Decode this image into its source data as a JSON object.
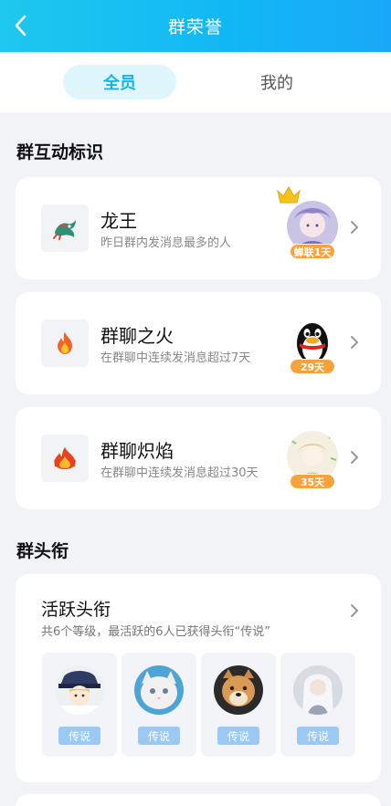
{
  "header": {
    "title": "群荣誉"
  },
  "tabs": [
    {
      "label": "全员",
      "active": true
    },
    {
      "label": "我的",
      "active": false
    }
  ],
  "interaction_section": {
    "title": "群互动标识",
    "items": [
      {
        "name": "龙王",
        "desc": "昨日群内发消息最多的人",
        "badge": "蝉联1天",
        "icon": "dragon-icon",
        "has_crown": true
      },
      {
        "name": "群聊之火",
        "desc": "在群聊中连续发消息超过7天",
        "badge": "29天",
        "icon": "fire-icon",
        "has_crown": false
      },
      {
        "name": "群聊炽焰",
        "desc": "在群聊中连续发消息超过30天",
        "badge": "35天",
        "icon": "flame-icon",
        "has_crown": false
      }
    ]
  },
  "title_section": {
    "title": "群头衔",
    "card": {
      "name": "活跃头衔",
      "desc": "共6个等级，最活跃的6人已获得头衔“传说”",
      "members": [
        {
          "badge": "传说"
        },
        {
          "badge": "传说"
        },
        {
          "badge": "传说"
        },
        {
          "badge": "传说"
        }
      ]
    }
  },
  "colors": {
    "accent": "#12b7f5",
    "badge_orange": "#f7a23b",
    "title_badge": "#9bc9f4"
  }
}
